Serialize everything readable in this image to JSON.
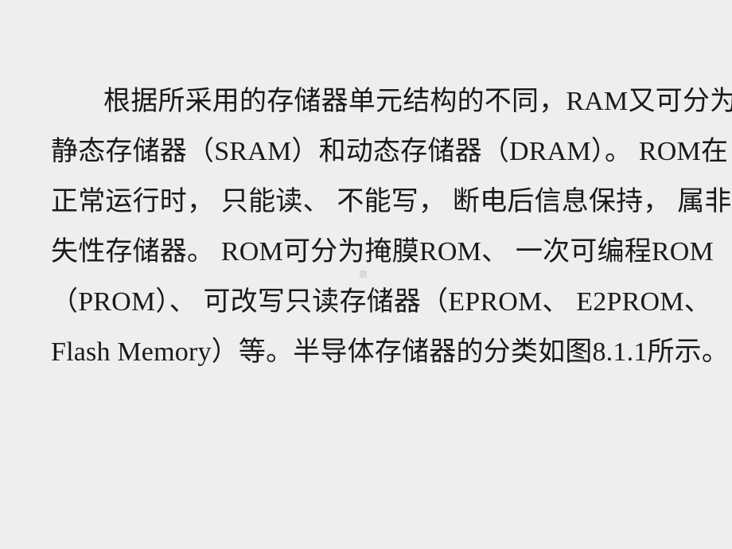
{
  "slide": {
    "background_color": "#eeeeee",
    "text_color": "#1a1a1a",
    "figure_reference": "图8.1.1",
    "lines": [
      "根据所采用的存储器单元结构的不同，RAM又可分为",
      "静态存储器（SRAM）和动态存储器（DRAM）。 ROM在",
      "正常运行时， 只能读、 不能写， 断电后信息保持， 属非易",
      "失性存储器。 ROM可分为掩膜ROM、 一次可编程ROM",
      "（PROM）、 可改写只读存储器（EPROM、 E2PROM、",
      "Flash Memory）等。半导体存储器的分类如图8.1.1所示。"
    ],
    "terms": [
      "RAM",
      "SRAM",
      "DRAM",
      "ROM",
      "PROM",
      "EPROM",
      "E2PROM",
      "Flash Memory"
    ],
    "paragraph_plain": "根据所采用的存储器单元结构的不同，RAM又可分为静态存储器（SRAM）和动态存储器（DRAM）。 ROM在正常运行时， 只能读、 不能写， 断电后信息保持， 属非易失性存储器。 ROM可分为掩膜ROM、 一次可编程ROM（PROM）、 可改写只读存储器（EPROM、 E2PROM、Flash Memory）等。半导体存储器的分类如图8.1.1所示。"
  }
}
